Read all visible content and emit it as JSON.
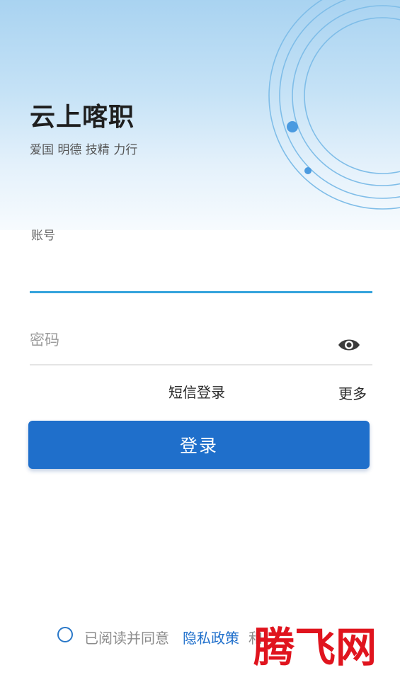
{
  "app": {
    "title": "云上喀职",
    "slogan": "爱国 明德 技精 力行"
  },
  "login_form": {
    "account_label": "账号",
    "account_value": "",
    "password_placeholder": "密码",
    "password_value": "",
    "sms_login_label": "短信登录",
    "more_label": "更多",
    "login_button_label": "登录"
  },
  "agreement": {
    "checked": false,
    "prefix_text": "已阅读并同意",
    "privacy_link_label": "隐私政策",
    "suffix_text": "和"
  },
  "watermark": {
    "text": "腾飞网"
  },
  "colors": {
    "accent": "#1f6fcb",
    "input_focus_line": "#35a3dc",
    "hero_top": "#a9d3f1",
    "watermark_red": "#e0141e"
  },
  "icons": {
    "password_toggle": "eye-icon",
    "agreement_checkbox": "radio-circle-icon"
  }
}
